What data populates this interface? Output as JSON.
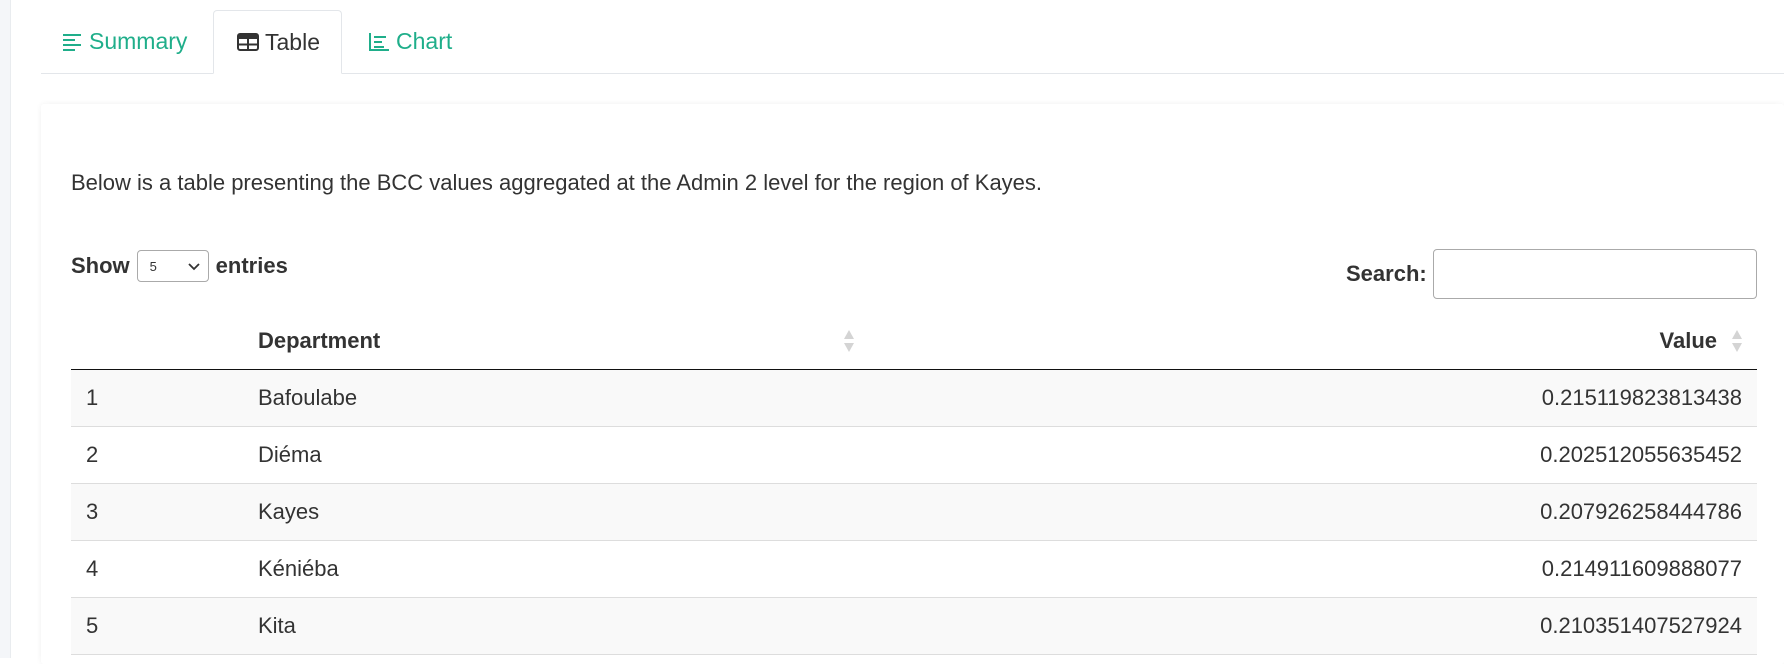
{
  "tabs": [
    {
      "label": "Summary",
      "icon": "align-left-icon"
    },
    {
      "label": "Table",
      "icon": "table-icon"
    },
    {
      "label": "Chart",
      "icon": "line-chart-icon"
    }
  ],
  "active_tab": "Table",
  "colors": {
    "accent": "#1fae8a",
    "text": "#333333"
  },
  "description": "Below is a table presenting the BCC values aggregated at the Admin 2 level for the region of Kayes.",
  "length_control": {
    "prefix": "Show",
    "value": "5",
    "suffix": "entries"
  },
  "search": {
    "label": "Search:",
    "value": ""
  },
  "table": {
    "columns": [
      "",
      "Department",
      "Value"
    ],
    "rows": [
      {
        "index": "1",
        "department": "Bafoulabe",
        "value": "0.215119823813438"
      },
      {
        "index": "2",
        "department": "Diéma",
        "value": "0.202512055635452"
      },
      {
        "index": "3",
        "department": "Kayes",
        "value": "0.207926258444786"
      },
      {
        "index": "4",
        "department": "Kéniéba",
        "value": "0.214911609888077"
      },
      {
        "index": "5",
        "department": "Kita",
        "value": "0.210351407527924"
      }
    ]
  }
}
